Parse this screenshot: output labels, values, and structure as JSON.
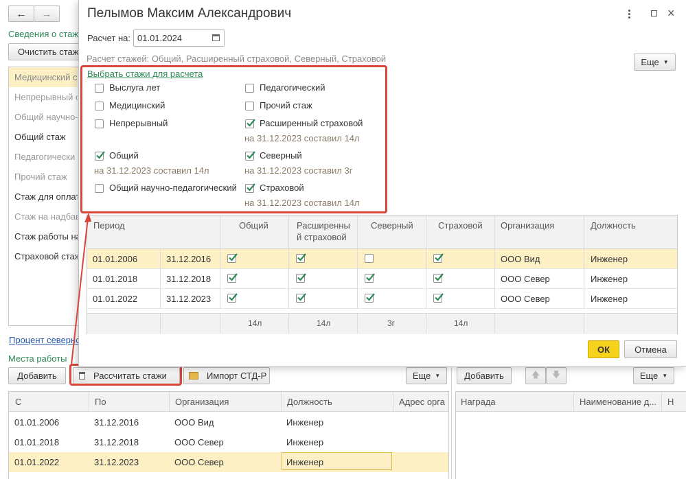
{
  "bg": {
    "nav_back": "←",
    "nav_forward": "→",
    "section_title": "Сведения о стаж",
    "clear_button": "Очистить стаж",
    "list": [
      {
        "label": "Медицинский ст",
        "style": "selected"
      },
      {
        "label": "Непрерывный с",
        "style": "gray"
      },
      {
        "label": "Общий научно-",
        "style": "gray"
      },
      {
        "label": "Общий стаж",
        "style": "normal"
      },
      {
        "label": "Педагогически",
        "style": "gray"
      },
      {
        "label": "Прочий стаж",
        "style": "gray"
      },
      {
        "label": "Стаж для оплат",
        "style": "normal"
      },
      {
        "label": "Стаж на надбав",
        "style": "gray"
      },
      {
        "label": "Стаж работы на",
        "style": "normal"
      },
      {
        "label": "Страховой стаж",
        "style": "normal"
      }
    ],
    "north_percent_link": "Процент северно",
    "workplaces_title": "Места работы",
    "add_button": "Добавить",
    "calc_button": "Рассчитать стажи",
    "import_button": "Импорт СТД-Р",
    "more_button": "Еще",
    "columns": [
      "С",
      "По",
      "Организация",
      "Должность",
      "Адрес орга"
    ],
    "rows": [
      [
        "01.01.2006",
        "31.12.2016",
        "ООО Вид",
        "Инженер"
      ],
      [
        "01.01.2018",
        "31.12.2018",
        "ООО Север",
        "Инженер"
      ],
      [
        "01.01.2022",
        "31.12.2023",
        "ООО Север",
        "Инженер"
      ]
    ],
    "right_add_button": "Добавить",
    "right_more_button": "Еще",
    "right_columns": [
      "Награда",
      "Наименование д...",
      "Н"
    ]
  },
  "dialog": {
    "title": "Пелымов Максим Александрович",
    "date_label": "Расчет на:",
    "date_value": "01.01.2024",
    "summary": "Расчет стажей: Общий, Расширенный страховой, Северный, Страховой",
    "more_button": "Еще",
    "select_link": "Выбрать стажи для расчета",
    "options_left": [
      {
        "label": "Выслуга лет",
        "checked": false,
        "note": ""
      },
      {
        "label": "Медицинский",
        "checked": false,
        "note": ""
      },
      {
        "label": "Непрерывный",
        "checked": false,
        "note": ""
      },
      {
        "label": "Общий",
        "checked": true,
        "note": "на 31.12.2023 составил 14л"
      },
      {
        "label": "Общий научно-педагогический",
        "checked": false,
        "note": ""
      }
    ],
    "options_right": [
      {
        "label": "Педагогический",
        "checked": false,
        "note": ""
      },
      {
        "label": "Прочий стаж",
        "checked": false,
        "note": ""
      },
      {
        "label": "Расширенный страховой",
        "checked": true,
        "note": "на 31.12.2023 составил 14л"
      },
      {
        "label": "Северный",
        "checked": true,
        "note": "на 31.12.2023 составил 3г"
      },
      {
        "label": "Страховой",
        "checked": true,
        "note": "на 31.12.2023 составил 14л"
      }
    ],
    "table": {
      "columns": [
        "Период",
        "Общий",
        "Расширенный страховой",
        "Северный",
        "Страховой",
        "Организация",
        "Должность"
      ],
      "column_2a": "Расширенны",
      "column_2b": "й страховой",
      "rows": [
        {
          "from": "01.01.2006",
          "to": "31.12.2016",
          "general": true,
          "extended": true,
          "north": false,
          "insurance": true,
          "org": "ООО Вид",
          "position": "Инженер"
        },
        {
          "from": "01.01.2018",
          "to": "31.12.2018",
          "general": true,
          "extended": true,
          "north": true,
          "insurance": true,
          "org": "ООО Север",
          "position": "Инженер"
        },
        {
          "from": "01.01.2022",
          "to": "31.12.2023",
          "general": true,
          "extended": true,
          "north": true,
          "insurance": true,
          "org": "ООО Север",
          "position": "Инженер"
        }
      ],
      "totals": [
        "14л",
        "14л",
        "3г",
        "14л"
      ]
    },
    "ok_button": "ОК",
    "cancel_button": "Отмена"
  },
  "colors": {
    "accent_green": "#2e8b57",
    "highlight_row": "#fdf0c5",
    "annotation_red": "#d9453b",
    "ok_yellow": "#f6d21c"
  }
}
